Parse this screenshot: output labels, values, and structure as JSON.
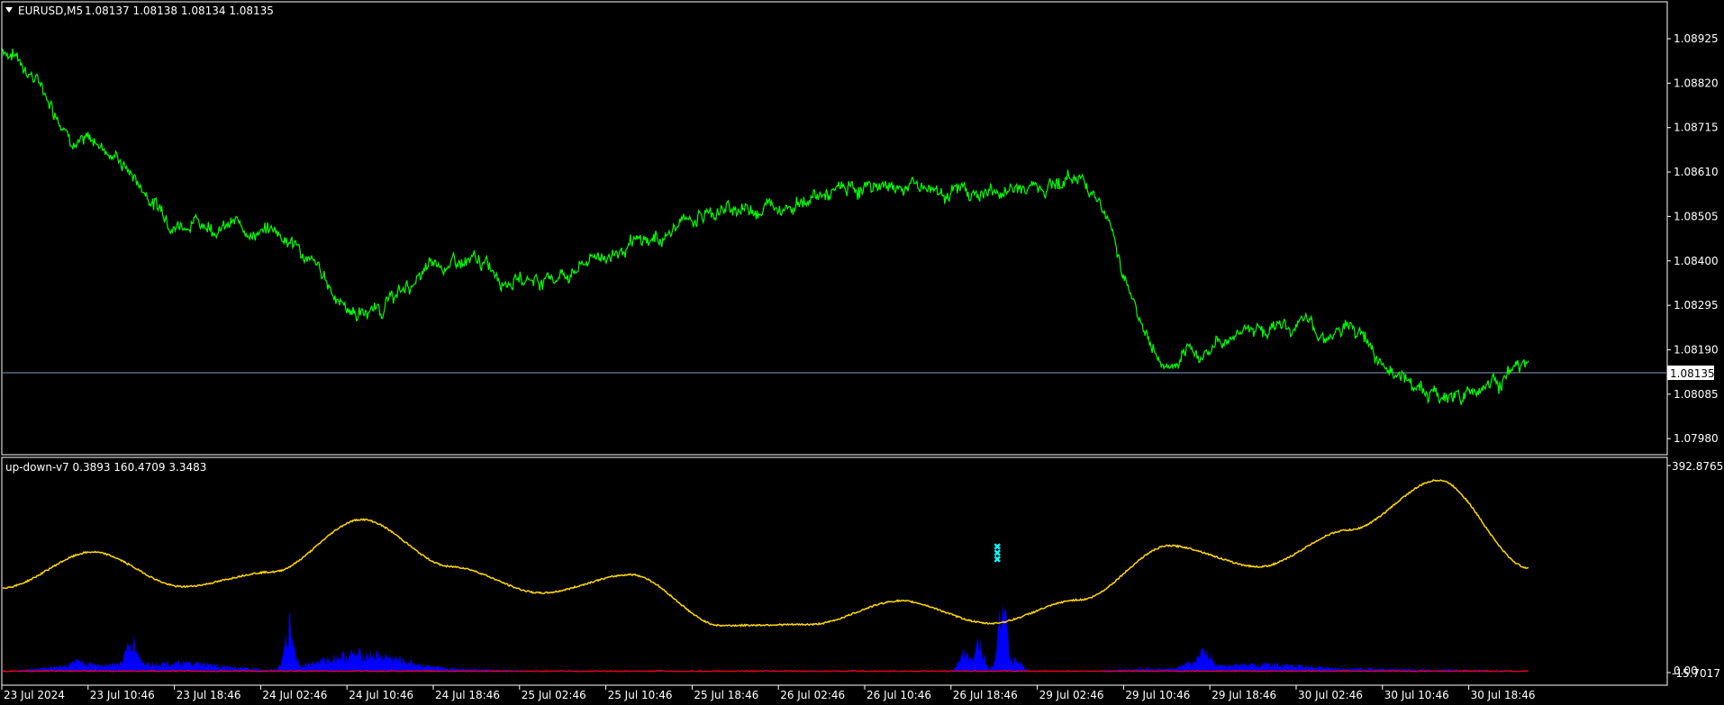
{
  "window": {
    "title": "EURUSD,M5",
    "quote": "1.08137 1.08138 1.08134 1.08135"
  },
  "colors": {
    "background": "#000000",
    "frame": "#ffffff",
    "price_line": "#00ff00",
    "bid_line": "#8aa0c8",
    "indicator_main": "#ffd700",
    "histogram_up": "#0000ff",
    "histogram_down": "#ff0000",
    "signal_marker": "#00ffff"
  },
  "price_panel": {
    "axis_labels": [
      "1.08925",
      "1.08820",
      "1.08715",
      "1.08610",
      "1.08505",
      "1.08400",
      "1.08295",
      "1.08190",
      "1.08085",
      "1.07980"
    ],
    "current_price_tag": "1.08135"
  },
  "indicator_panel": {
    "label": "up-down-v7 0.3893 160.4709 3.3483",
    "axis_top": "392.8765",
    "axis_bottom": "0.00",
    "axis_bottom_partial": "-15.7017"
  },
  "time_axis": {
    "labels": [
      "23 Jul 2024",
      "23 Jul 10:46",
      "23 Jul 18:46",
      "24 Jul 02:46",
      "24 Jul 10:46",
      "24 Jul 18:46",
      "25 Jul 02:46",
      "25 Jul 10:46",
      "25 Jul 18:46",
      "26 Jul 02:46",
      "26 Jul 10:46",
      "26 Jul 18:46",
      "29 Jul 02:46",
      "29 Jul 10:46",
      "29 Jul 18:46",
      "30 Jul 02:46",
      "30 Jul 10:46",
      "30 Jul 18:46"
    ]
  },
  "chart_data": [
    {
      "type": "line",
      "symbol": "EURUSD",
      "timeframe": "M5",
      "x": [
        "23 Jul 2024",
        "23 Jul 10:46",
        "23 Jul 18:46",
        "24 Jul 02:46",
        "24 Jul 10:46",
        "24 Jul 18:46",
        "25 Jul 02:46",
        "25 Jul 10:46",
        "25 Jul 18:46",
        "26 Jul 02:46",
        "26 Jul 10:46",
        "26 Jul 18:46",
        "29 Jul 02:46",
        "29 Jul 10:46",
        "29 Jul 18:46",
        "30 Jul 02:46",
        "30 Jul 10:46",
        "30 Jul 18:46"
      ],
      "series": [
        {
          "values": [
            1.089,
            1.0868,
            1.085,
            1.0847,
            1.0828,
            1.0839,
            1.0836,
            1.0843,
            1.0852,
            1.0855,
            1.0858,
            1.0856,
            1.086,
            1.0815,
            1.0825,
            1.0823,
            1.0808,
            1.0814
          ]
        }
      ],
      "ylim": [
        1.0794,
        1.0898
      ],
      "grid": false
    },
    {
      "type": "line",
      "indicator": "up-down-v7",
      "x": [
        "23 Jul 2024",
        "23 Jul 10:46",
        "23 Jul 18:46",
        "24 Jul 02:46",
        "24 Jul 10:46",
        "24 Jul 18:46",
        "25 Jul 02:46",
        "25 Jul 10:46",
        "25 Jul 18:46",
        "26 Jul 02:46",
        "26 Jul 10:46",
        "26 Jul 18:46",
        "29 Jul 02:46",
        "29 Jul 10:46",
        "29 Jul 18:46",
        "30 Jul 02:46",
        "30 Jul 10:46",
        "30 Jul 18:46"
      ],
      "series": [
        {
          "values": [
            160,
            228,
            162,
            190,
            290,
            200,
            150,
            185,
            88,
            90,
            135,
            92,
            137,
            240,
            200,
            270,
            365,
            198
          ]
        },
        {
          "values": [
            2,
            14,
            16,
            4,
            34,
            6,
            2,
            2,
            2,
            2,
            2,
            2,
            2,
            6,
            14,
            6,
            4,
            2
          ]
        }
      ],
      "ylim": [
        -15.7017,
        392.8765
      ],
      "grid": false
    }
  ]
}
